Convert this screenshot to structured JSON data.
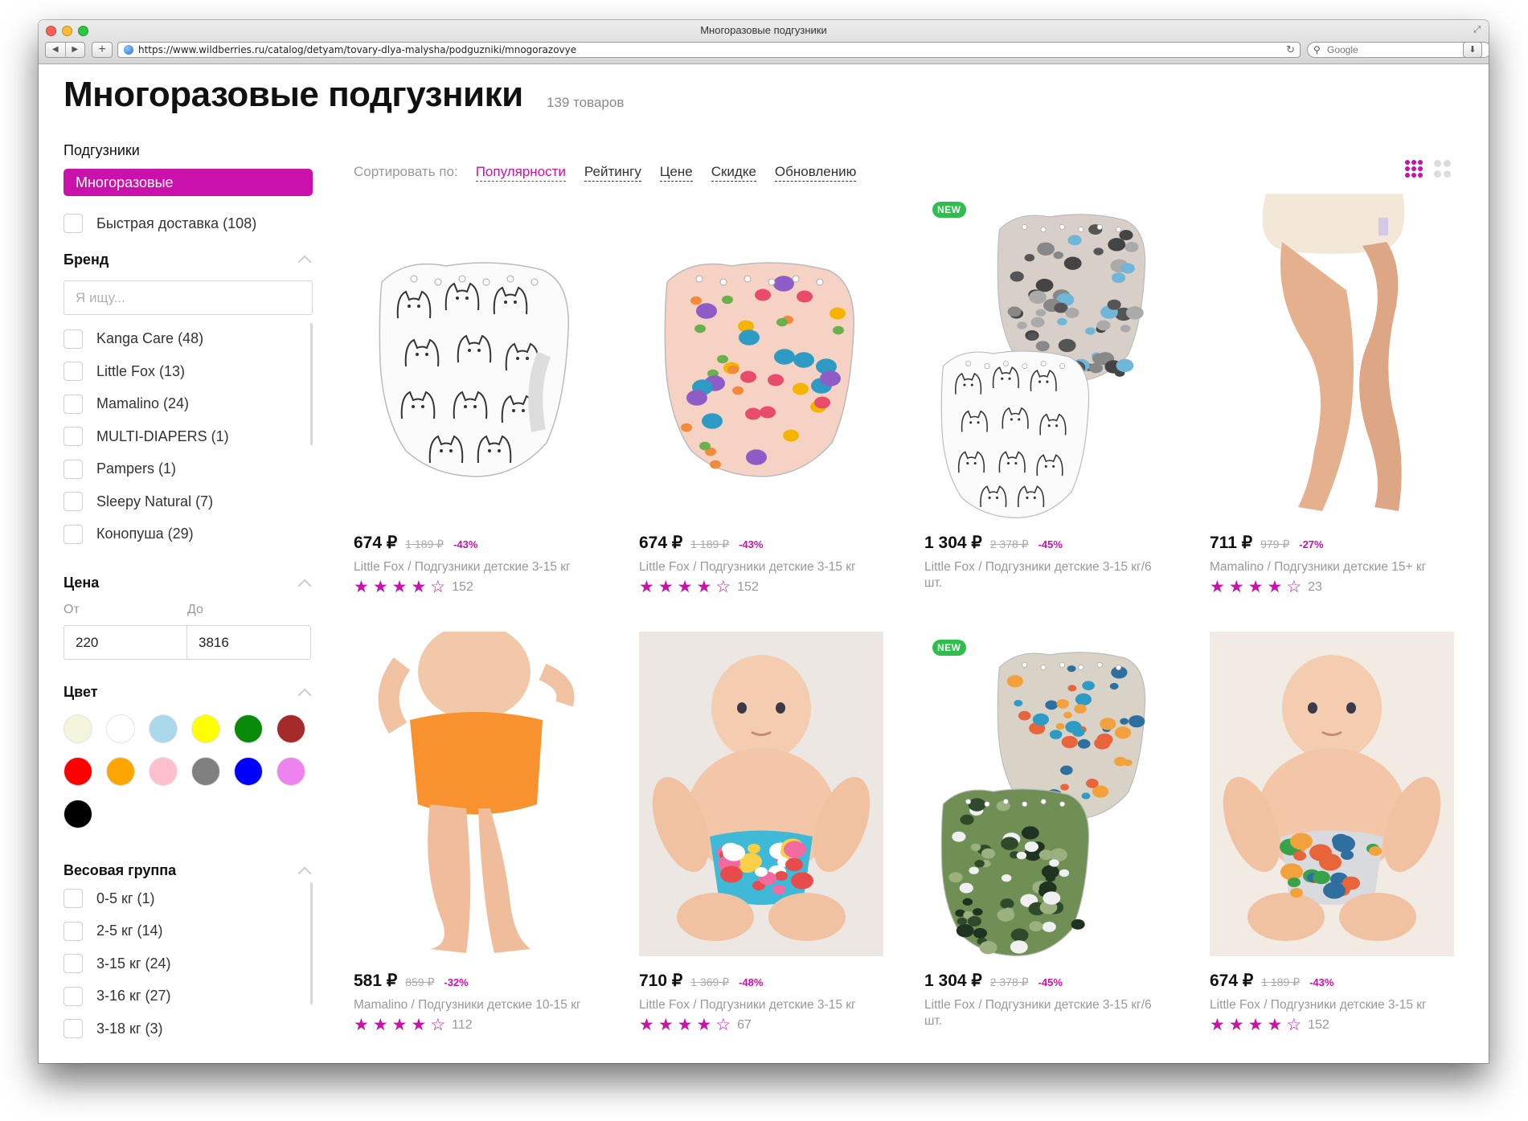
{
  "window": {
    "title": "Многоразовые подгузники",
    "url": "https://www.wildberries.ru/catalog/detyam/tovary-dlya-malysha/podguzniki/mnogorazovye",
    "search_placeholder": "Google"
  },
  "page": {
    "title": "Многоразовые подгузники",
    "count": "139 товаров"
  },
  "sidebar": {
    "category_heading": "Подгузники",
    "active_category": "Многоразовые",
    "fast_delivery": "Быстрая доставка (108)",
    "brand": {
      "heading": "Бренд",
      "search_placeholder": "Я ищу...",
      "items": [
        "Kanga Care (48)",
        "Little Fox (13)",
        "Mamalino (24)",
        "MULTI-DIAPERS (1)",
        "Pampers (1)",
        "Sleepy Natural (7)",
        "Конопуша (29)"
      ]
    },
    "price": {
      "heading": "Цена",
      "from_label": "От",
      "to_label": "До",
      "from_value": "220",
      "to_value": "3816"
    },
    "color": {
      "heading": "Цвет",
      "swatches": [
        "#f3f5dd",
        "#ffffff",
        "#a9d8ea",
        "#ffff00",
        "#0a8a0a",
        "#a52a2a",
        "#ff0000",
        "#ffa500",
        "#ffc0cb",
        "#808080",
        "#0000ff",
        "#ee82ee",
        "#000000"
      ]
    },
    "weight": {
      "heading": "Весовая группа",
      "items": [
        "0-5 кг (1)",
        "2-5 кг (14)",
        "3-15 кг (24)",
        "3-16 кг (27)",
        "3-18 кг (3)"
      ]
    }
  },
  "sort": {
    "label": "Сортировать по:",
    "options": [
      "Популярности",
      "Рейтингу",
      "Цене",
      "Скидке",
      "Обновлению"
    ]
  },
  "colors": {
    "accent": "#cb11ab",
    "new_badge": "#2dbe4e"
  },
  "products": [
    {
      "price": "674 ₽",
      "old_price": "1 189 ₽",
      "discount": "-43%",
      "name": "Little Fox / Подгузники детские 3-15 кг",
      "rating": 4,
      "reviews": "152",
      "badge": "",
      "image": "diaper-cats"
    },
    {
      "price": "674 ₽",
      "old_price": "1 189 ₽",
      "discount": "-43%",
      "name": "Little Fox / Подгузники детские 3-15 кг",
      "rating": 4,
      "reviews": "152",
      "badge": "",
      "image": "diaper-fox-pink"
    },
    {
      "price": "1 304 ₽",
      "old_price": "2 378 ₽",
      "discount": "-45%",
      "name": "Little Fox / Подгузники детские 3-15 кг/6 шт.",
      "rating": 0,
      "reviews": "",
      "badge": "NEW",
      "image": "diaper-set-leaves-cats"
    },
    {
      "price": "711 ₽",
      "old_price": "979 ₽",
      "discount": "-27%",
      "name": "Mamalino / Подгузники детские 15+ кг",
      "rating": 4,
      "reviews": "23",
      "badge": "",
      "image": "baby-legs-cream-diaper"
    },
    {
      "price": "581 ₽",
      "old_price": "859 ₽",
      "discount": "-32%",
      "name": "Mamalino / Подгузники детские 10-15 кг",
      "rating": 4,
      "reviews": "112",
      "badge": "",
      "image": "baby-orange-diaper"
    },
    {
      "price": "710 ₽",
      "old_price": "1 369 ₽",
      "discount": "-48%",
      "name": "Little Fox / Подгузники детские 3-15 кг",
      "rating": 4,
      "reviews": "67",
      "badge": "",
      "image": "baby-floral-diaper"
    },
    {
      "price": "1 304 ₽",
      "old_price": "2 378 ₽",
      "discount": "-45%",
      "name": "Little Fox / Подгузники детские 3-15 кг/6 шт.",
      "rating": 0,
      "reviews": "",
      "badge": "NEW",
      "image": "diaper-set-dino-camo"
    },
    {
      "price": "674 ₽",
      "old_price": "1 189 ₽",
      "discount": "-43%",
      "name": "Little Fox / Подгузники детские 3-15 кг",
      "rating": 4,
      "reviews": "152",
      "badge": "",
      "image": "baby-dino-diaper"
    }
  ]
}
